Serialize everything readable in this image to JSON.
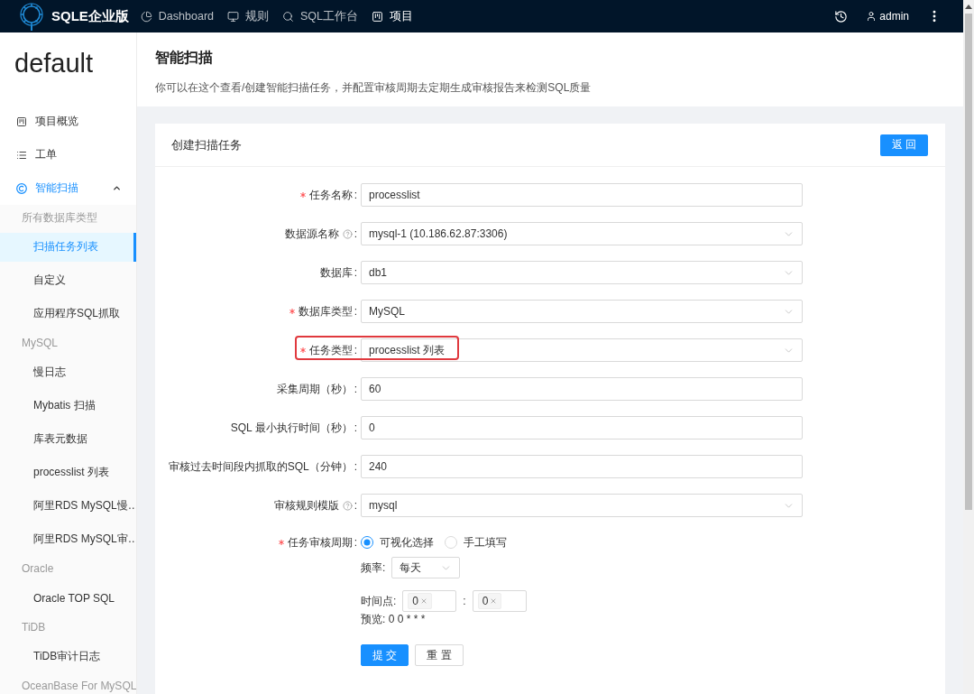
{
  "top_bar": {
    "brand": "SQLE企业版",
    "nav": [
      {
        "label": "Dashboard",
        "selected": false
      },
      {
        "label": "规则",
        "selected": false
      },
      {
        "label": "SQL工作台",
        "selected": false
      },
      {
        "label": "项目",
        "selected": true
      }
    ],
    "user": "admin"
  },
  "sidebar": {
    "project": "default",
    "items": [
      {
        "label": "项目概览",
        "selected": false
      },
      {
        "label": "工单",
        "selected": false
      },
      {
        "label": "智能扫描",
        "selected": false,
        "expanded": true,
        "children": [
          {
            "title": "所有数据库类型",
            "children": [
              {
                "label": "扫描任务列表",
                "selected": true
              },
              {
                "label": "自定义",
                "selected": false
              },
              {
                "label": "应用程序SQL抓取",
                "selected": false
              }
            ]
          },
          {
            "title": "MySQL",
            "children": [
              {
                "label": "慢日志",
                "selected": false
              },
              {
                "label": "Mybatis 扫描",
                "selected": false
              },
              {
                "label": "库表元数据",
                "selected": false
              },
              {
                "label": "processlist 列表",
                "selected": false
              },
              {
                "label": "阿里RDS MySQL慢…",
                "selected": false
              },
              {
                "label": "阿里RDS MySQL审…",
                "selected": false
              }
            ]
          },
          {
            "title": "Oracle",
            "children": [
              {
                "label": "Oracle TOP SQL",
                "selected": false
              }
            ]
          },
          {
            "title": "TiDB",
            "children": [
              {
                "label": "TiDB审计日志",
                "selected": false
              }
            ]
          },
          {
            "title": "OceanBase For MySQL"
          }
        ]
      }
    ]
  },
  "page": {
    "title": "智能扫描",
    "description": "你可以在这个查看/创建智能扫描任务，并配置审核周期去定期生成审核报告来检测SQL质量"
  },
  "card": {
    "title": "创建扫描任务",
    "back_button": "返 回"
  },
  "form": {
    "fields": [
      {
        "label": "任务名称",
        "colon": ":",
        "required": true,
        "help": false,
        "kind": "input",
        "value": "processlist",
        "highlighted": false
      },
      {
        "label": "数据源名称",
        "colon": ":",
        "required": false,
        "help": true,
        "kind": "select",
        "value": "mysql-1 (10.186.62.87:3306)",
        "highlighted": false
      },
      {
        "label": "数据库",
        "colon": ":",
        "required": false,
        "help": false,
        "kind": "select",
        "value": "db1",
        "highlighted": false
      },
      {
        "label": "数据库类型",
        "colon": ":",
        "required": true,
        "help": false,
        "kind": "select",
        "value": "MySQL",
        "highlighted": false
      },
      {
        "label": "任务类型",
        "colon": ":",
        "required": true,
        "help": false,
        "kind": "select",
        "value": "processlist 列表",
        "highlighted": true
      },
      {
        "label": "采集周期（秒）",
        "colon": ":",
        "required": false,
        "help": false,
        "kind": "input",
        "value": "60",
        "highlighted": false
      },
      {
        "label": "SQL 最小执行时间（秒）",
        "colon": ":",
        "required": false,
        "help": false,
        "kind": "input",
        "value": "0",
        "highlighted": false
      },
      {
        "label": "审核过去时间段内抓取的SQL（分钟）",
        "colon": ":",
        "required": false,
        "help": false,
        "kind": "input",
        "value": "240",
        "highlighted": false
      },
      {
        "label": "审核规则模版",
        "colon": ":",
        "required": false,
        "help": true,
        "kind": "select",
        "value": "mysql",
        "highlighted": false
      }
    ],
    "schedule": {
      "label": "任务审核周期",
      "colon": ":",
      "required": true,
      "options": [
        {
          "label": "可视化选择",
          "selected": true
        },
        {
          "label": "手工填写",
          "selected": false
        }
      ],
      "frequency": {
        "label": "频率:",
        "value": "每天"
      },
      "time": {
        "label": "时间点:",
        "separator": ":",
        "hour": "0",
        "minute": "0"
      },
      "preview": "预览: 0 0 * * *"
    },
    "buttons": [
      {
        "label": "提 交",
        "kind": "primary"
      },
      {
        "label": "重 置",
        "kind": "default"
      }
    ]
  }
}
